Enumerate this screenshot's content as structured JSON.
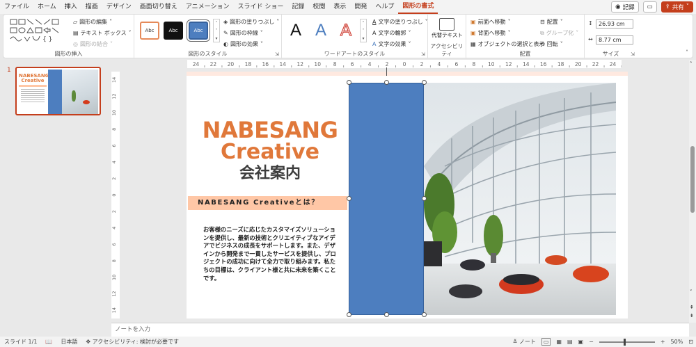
{
  "menu": {
    "tabs": [
      "ファイル",
      "ホーム",
      "挿入",
      "描画",
      "デザイン",
      "画面切り替え",
      "アニメーション",
      "スライド ショー",
      "記録",
      "校閲",
      "表示",
      "開発",
      "ヘルプ",
      "図形の書式"
    ],
    "active_tab": "図形の書式",
    "record_label": "記録",
    "share_label": "共有"
  },
  "ribbon": {
    "insert_shapes": {
      "label": "図形の挿入",
      "edit_shape": "図形の編集",
      "text_box": "テキスト ボックス",
      "merge_shapes": "図形の結合"
    },
    "shape_styles": {
      "label": "図形のスタイル",
      "swatch_text": "Abc",
      "fill": "図形の塗りつぶし",
      "outline": "図形の枠線",
      "effects": "図形の効果"
    },
    "wordart": {
      "label": "ワードアートのスタイル",
      "letter": "A",
      "text_fill": "文字の塗りつぶし",
      "text_outline": "文字の輪郭",
      "text_effects": "文字の効果"
    },
    "accessibility": {
      "label": "アクセシビリティ",
      "alt_text": "代替テキスト"
    },
    "arrange": {
      "label": "配置",
      "bring_forward": "前面へ移動",
      "send_backward": "背面へ移動",
      "selection_pane": "オブジェクトの選択と表示",
      "align": "配置",
      "group": "グループ化",
      "rotate": "回転"
    },
    "size": {
      "label": "サイズ",
      "height": "26.93 cm",
      "width": "8.77 cm"
    }
  },
  "thumbnail": {
    "number": "1"
  },
  "ruler": {
    "ticks": [
      "24",
      "22",
      "20",
      "18",
      "16",
      "14",
      "12",
      "10",
      "8",
      "6",
      "4",
      "2",
      "0",
      "2",
      "4",
      "6",
      "8",
      "10",
      "12",
      "14",
      "16",
      "18",
      "20",
      "22",
      "24"
    ],
    "v_ticks": [
      "14",
      "12",
      "10",
      "8",
      "6",
      "4",
      "2",
      "0",
      "2",
      "4",
      "6",
      "8",
      "10",
      "12",
      "14"
    ]
  },
  "slide": {
    "title_line1": "NABESANG",
    "title_line2": "Creative",
    "subtitle": "会社案内",
    "banner": "NABESANG Creativeとは？",
    "body": "お客様のニーズに応じたカスタマイズソリューションを提供し、最新の技術とクリエイティブなアイデアでビジネスの成長をサポートします。また、デザインから開発まで一貫したサービスを提供し、プロジェクトの成功に向けて全力で取り組みます。私たちの目標は、クライアント様と共に未来を築くことです。"
  },
  "notes": {
    "placeholder": "ノートを入力"
  },
  "status": {
    "slide_info": "スライド 1/1",
    "language": "日本語",
    "accessibility": "アクセシビリティ: 検討が必要です",
    "notes_label": "ノート",
    "zoom": "50%"
  },
  "colors": {
    "accent": "#c43e1c",
    "title_orange": "#e0783a",
    "banner_peach": "#ffc7a6",
    "shape_blue": "#4d7ebf"
  }
}
